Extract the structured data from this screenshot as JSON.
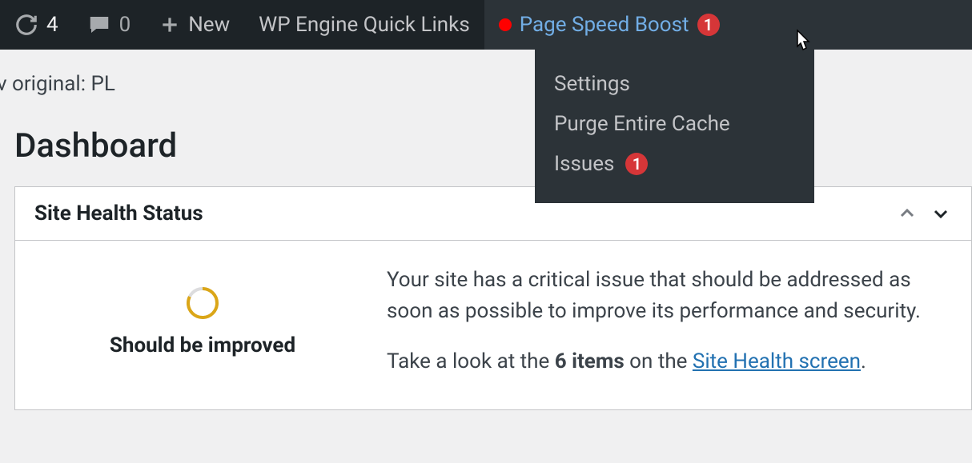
{
  "adminbar": {
    "updates_count": "4",
    "comments_count": "0",
    "new_label": "New",
    "wpe_label": "WP Engine Quick Links",
    "psb_label": "Page Speed Boost",
    "psb_badge": "1"
  },
  "submenu": {
    "settings": "Settings",
    "purge": "Purge Entire Cache",
    "issues_label": "Issues",
    "issues_count": "1"
  },
  "page": {
    "original_line": "v original: PL",
    "title": "Dashboard"
  },
  "site_health": {
    "panel_title": "Site Health Status",
    "status_label": "Should be improved",
    "msg1": "Your site has a critical issue that should be addressed as soon as possible to improve its performance and security.",
    "msg2_pre": "Take a look at the ",
    "msg2_bold": "6 items",
    "msg2_mid": " on the ",
    "msg2_link": "Site Health screen",
    "msg2_post": "."
  }
}
